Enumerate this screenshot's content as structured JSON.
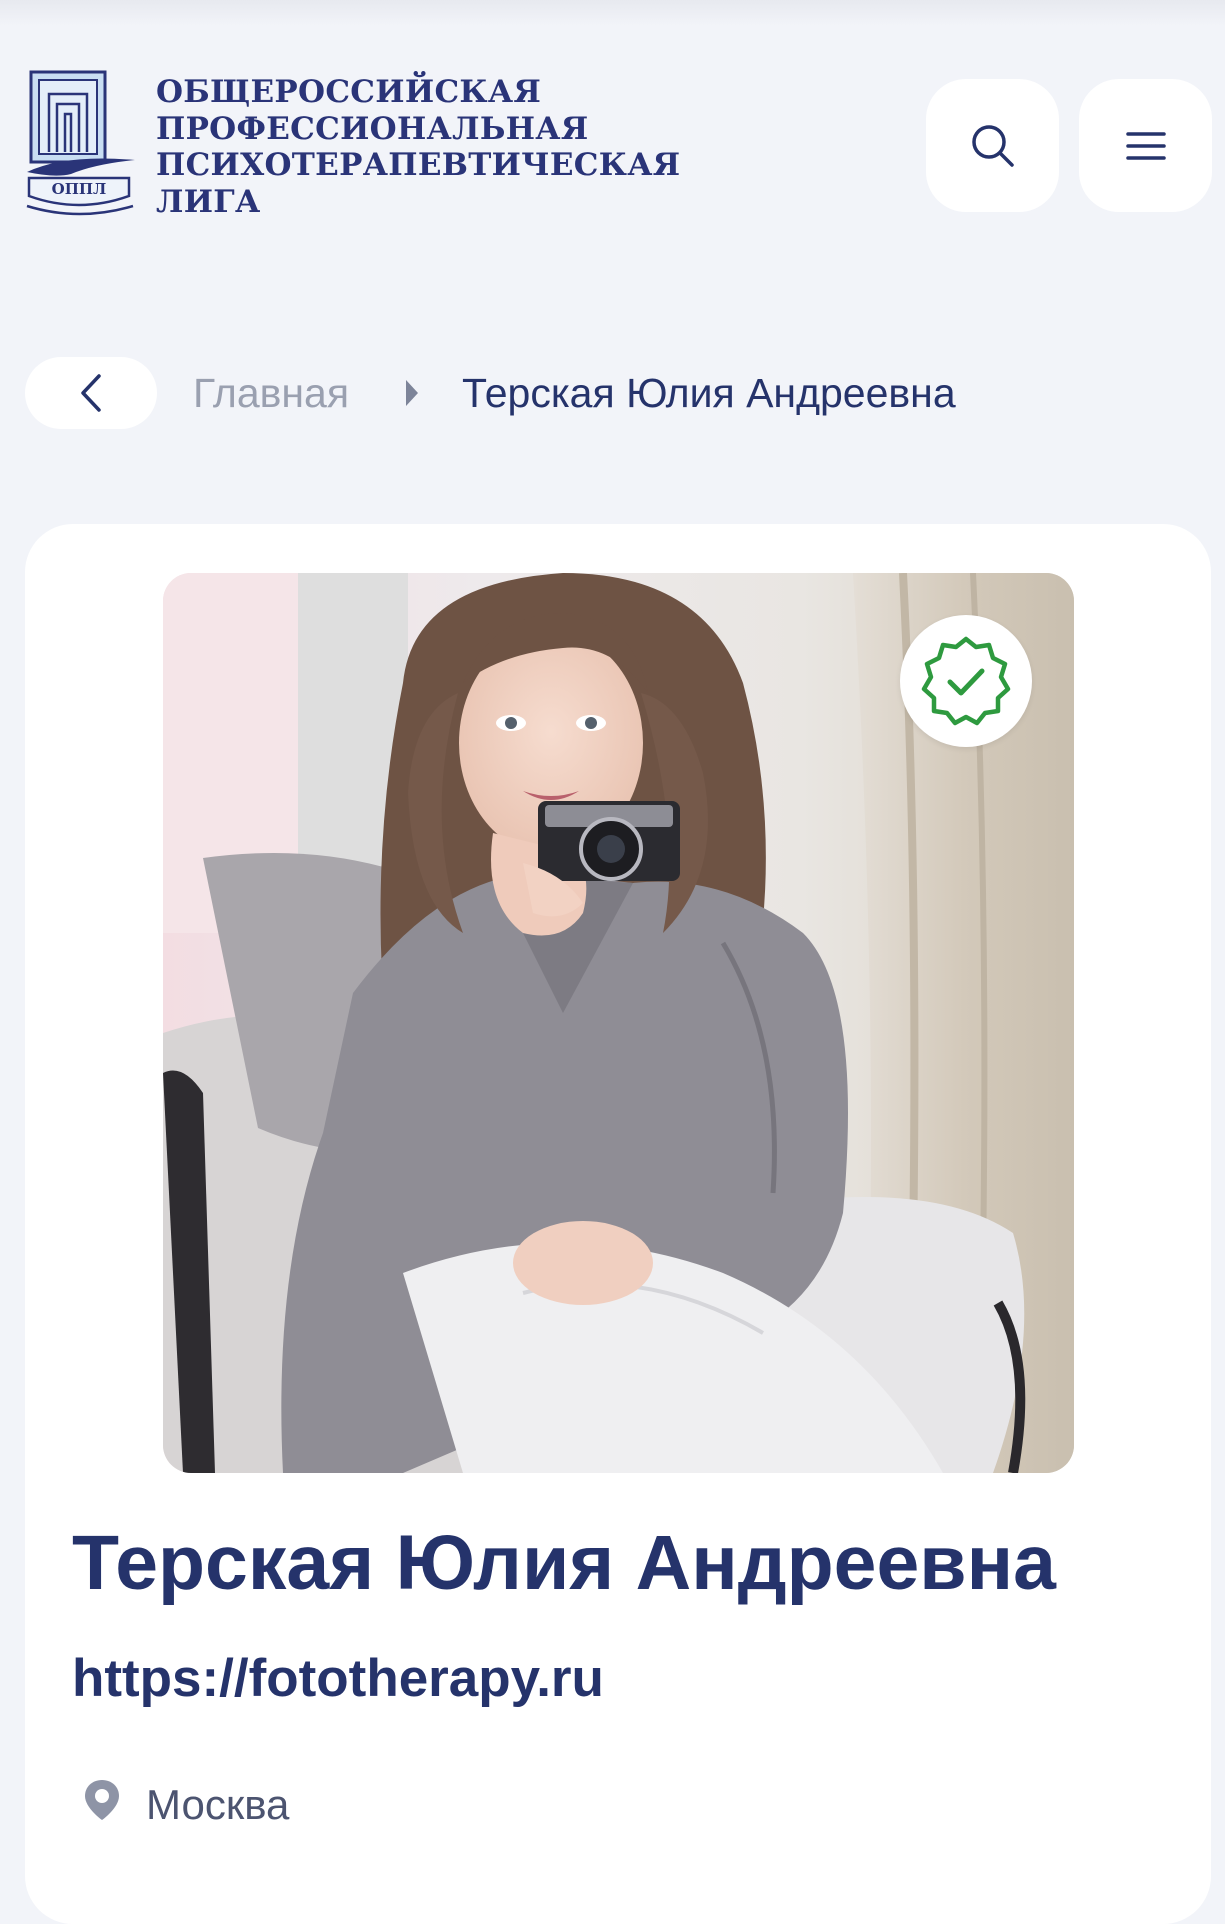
{
  "header": {
    "logo_lines": [
      "ОБЩЕРОССИЙСКАЯ",
      "ПРОФЕССИОНАЛЬНАЯ",
      "ПСИХОТЕРАПЕВТИЧЕСКАЯ",
      "ЛИГА"
    ],
    "logo_emblem_text": "ОППЛ",
    "search_icon": "search-icon",
    "menu_icon": "hamburger-menu-icon"
  },
  "breadcrumb": {
    "back_icon": "chevron-left-icon",
    "home": "Главная",
    "separator_icon": "caret-right-icon",
    "current": "Терская Юлия Андреевна"
  },
  "profile": {
    "photo_icon": "profile-photo",
    "verified_icon": "verified-badge-icon",
    "name": "Терская Юлия Андреевна",
    "website": "https://fototherapy.ru",
    "location_icon": "location-pin-icon",
    "city": "Москва"
  },
  "colors": {
    "background": "#f2f4f9",
    "primary_text": "#25336b",
    "muted_text": "#9aa0b0",
    "verified_green": "#2e9a3f"
  }
}
